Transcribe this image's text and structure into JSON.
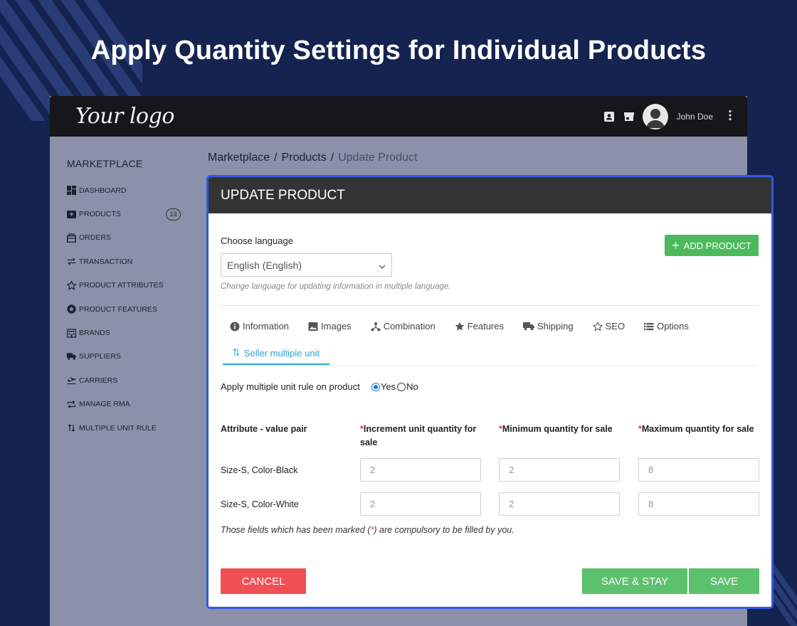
{
  "hero": {
    "title": "Apply Quantity Settings for Individual Products"
  },
  "topbar": {
    "logo": "Your logo",
    "username": "John Doe"
  },
  "sidebar": {
    "heading": "MARKETPLACE",
    "items": [
      {
        "label": "DASHBOARD",
        "icon": "dashboard-icon"
      },
      {
        "label": "PRODUCTS",
        "icon": "products-icon",
        "badge": "13"
      },
      {
        "label": "ORDERS",
        "icon": "orders-icon"
      },
      {
        "label": "TRANSACTION",
        "icon": "transaction-icon"
      },
      {
        "label": "PRODUCT ATTRIBUTES",
        "icon": "attributes-icon"
      },
      {
        "label": "PRODUCT FEATURES",
        "icon": "features-icon"
      },
      {
        "label": "BRANDS",
        "icon": "brands-icon"
      },
      {
        "label": "SUPPLIERS",
        "icon": "truck-icon"
      },
      {
        "label": "CARRIERS",
        "icon": "plane-icon"
      },
      {
        "label": "MANAGE RMA",
        "icon": "rma-icon"
      },
      {
        "label": "MULTIPLE UNIT RULE",
        "icon": "sort-arrows-icon"
      }
    ]
  },
  "breadcrumb": {
    "items": [
      "Marketplace",
      "Products"
    ],
    "current": "Update Product",
    "separator": "/"
  },
  "card": {
    "title": "UPDATE PRODUCT",
    "language_label": "Choose language",
    "language_value": "English (English)",
    "language_hint": "Change language for updating information in multiple language.",
    "add_product": "ADD PRODUCT",
    "tabs": [
      "Information",
      "Images",
      "Combination",
      "Features",
      "Shipping",
      "SEO",
      "Options"
    ],
    "active_tab": "Seller multiple unit",
    "apply_label": "Apply multiple unit rule on product",
    "apply_yes": "Yes",
    "apply_no": "No",
    "apply_selected": "Yes",
    "columns": {
      "pair": "Attribute - value pair",
      "increment": "Increment unit quantity for sale",
      "minimum": "Minimum quantity for sale",
      "maximum": "Maximum quantity for sale",
      "required_mark": "*"
    },
    "rows": [
      {
        "pair": "Size-S, Color-Black",
        "increment": "2",
        "minimum": "2",
        "maximum": "8"
      },
      {
        "pair": "Size-S, Color-White",
        "increment": "2",
        "minimum": "2",
        "maximum": "8"
      }
    ],
    "note_before": "Those fields which has been marked (",
    "note_mark": "*",
    "note_after": ") are compulsory to be filled by you.",
    "cancel": "CANCEL",
    "save_stay": "SAVE & STAY",
    "save": "SAVE"
  },
  "colors": {
    "background": "#14234f",
    "active_border": "#3358e6",
    "success": "#5cc16c",
    "danger": "#f05054",
    "tab_active": "#2aa3d6"
  }
}
